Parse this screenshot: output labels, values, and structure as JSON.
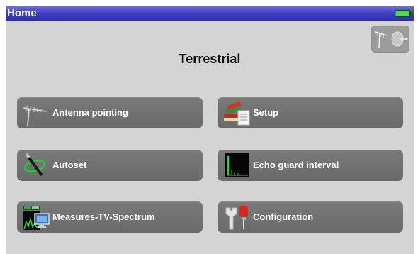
{
  "header": {
    "title": "Home",
    "battery_icon": "battery-icon"
  },
  "mode_toggle": {
    "icons": [
      "antenna-icon",
      "satellite-dish-icon"
    ]
  },
  "main": {
    "title": "Terrestrial",
    "buttons": [
      {
        "label": "Antenna pointing",
        "icon": "antenna-icon"
      },
      {
        "label": "Setup",
        "icon": "setup-books-icon"
      },
      {
        "label": "Autoset",
        "icon": "autoset-wand-icon"
      },
      {
        "label": "Echo guard interval",
        "icon": "echo-graph-icon"
      },
      {
        "label": "Measures-TV-Spectrum",
        "icon": "spectrum-tv-icon"
      },
      {
        "label": "Configuration",
        "icon": "configuration-tools-icon"
      }
    ]
  },
  "colors": {
    "titlebar": "#3a3abf",
    "background": "#d4d4d4",
    "button": "#717171",
    "battery": "#3fbf3f"
  }
}
